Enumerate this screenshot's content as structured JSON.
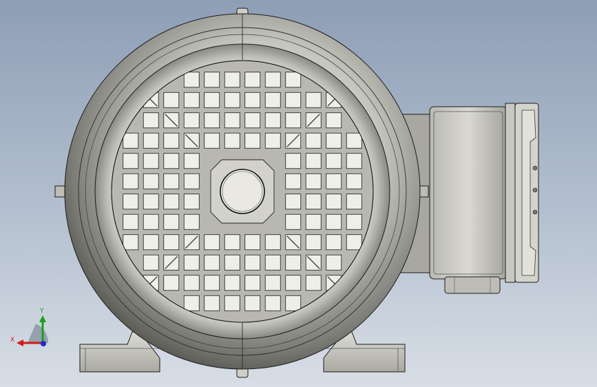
{
  "viewport": {
    "background_top": "#8e9eb6",
    "background_bottom": "#d8dee6"
  },
  "model": {
    "description_icon": "electric-motor-rear-view",
    "body_color": "#9e9e97",
    "grille_color": "#c9c9c2",
    "edge_color": "#1a1a1a"
  },
  "triad": {
    "x_label": "X",
    "y_label": "Y",
    "x_color": "#d11a1a",
    "y_color": "#18a018",
    "z_color": "#1a2ad1"
  }
}
